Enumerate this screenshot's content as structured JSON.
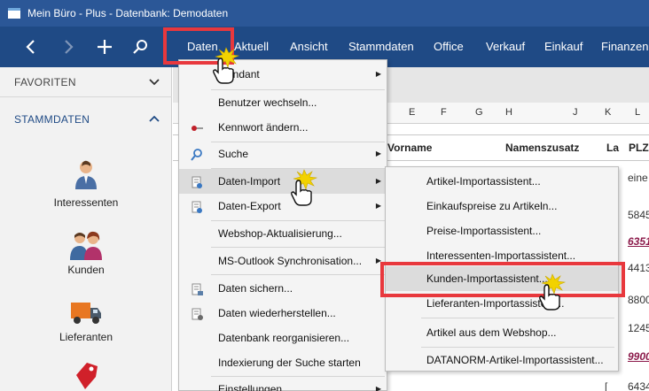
{
  "window": {
    "title": "Mein Büro - Plus - Datenbank: Demodaten"
  },
  "menubar": {
    "back_icon": "chevron-left-icon",
    "forward_icon": "chevron-right-icon",
    "add_icon": "plus-icon",
    "search_icon": "search-icon",
    "items": [
      "Daten",
      "Aktuell",
      "Ansicht",
      "Stammdaten",
      "Office",
      "Verkauf",
      "Einkauf",
      "Finanzen"
    ]
  },
  "sidebar": {
    "favorites": "FAVORITEN",
    "stammdaten": "STAMMDATEN",
    "items": [
      "Interessenten",
      "Kunden",
      "Lieferanten"
    ]
  },
  "grid": {
    "col_letters": [
      "E",
      "F",
      "G",
      "H",
      "J",
      "K",
      "L"
    ],
    "headers": [
      "Vorname",
      "Namenszusatz",
      "La",
      "PLZ"
    ],
    "plz_cells": [
      "eine",
      "5845",
      "6351",
      "4413",
      "8800",
      "1245",
      "9900",
      "6434"
    ],
    "la_cells": [
      "[",
      "["
    ]
  },
  "dropdown": {
    "items": [
      {
        "label": "Mandant",
        "has_sub": true
      },
      {
        "label": "Benutzer wechseln...",
        "has_sub": false
      },
      {
        "label": "Kennwort ändern...",
        "has_sub": false,
        "icon": "key-icon"
      },
      {
        "label": "Suche",
        "has_sub": true,
        "icon": "magnifier-icon"
      },
      {
        "label": "Daten-Import",
        "has_sub": true,
        "icon": "document-import-icon"
      },
      {
        "label": "Daten-Export",
        "has_sub": true,
        "icon": "document-export-icon"
      },
      {
        "label": "Webshop-Aktualisierung...",
        "has_sub": false
      },
      {
        "label": "MS-Outlook Synchronisation...",
        "has_sub": true
      },
      {
        "label": "Daten sichern...",
        "has_sub": false,
        "icon": "backup-icon"
      },
      {
        "label": "Daten wiederherstellen...",
        "has_sub": false,
        "icon": "restore-icon"
      },
      {
        "label": "Datenbank reorganisieren...",
        "has_sub": false
      },
      {
        "label": "Indexierung der Suche starten",
        "has_sub": false
      },
      {
        "label": "Einstellungen",
        "has_sub": true
      }
    ]
  },
  "submenu": {
    "items": [
      "Artikel-Importassistent...",
      "Einkaufspreise zu Artikeln...",
      "Preise-Importassistent...",
      "Interessenten-Importassistent...",
      "Kunden-Importassistent...",
      "Lieferanten-Importassistent...",
      "Artikel aus dem Webshop...",
      "DATANORM-Artikel-Importassistent..."
    ]
  },
  "colors": {
    "titlebar": "#2b5797",
    "menubar": "#1f4a85",
    "highlight": "#e8383d",
    "accent": "#1f4a85"
  }
}
